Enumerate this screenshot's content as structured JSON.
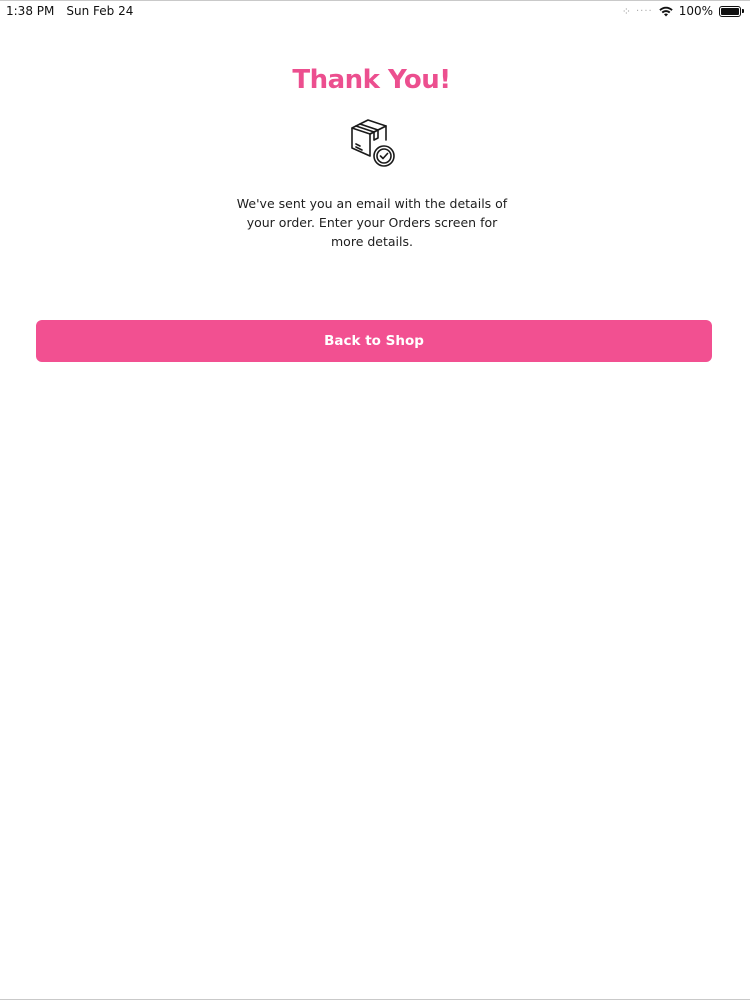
{
  "status_bar": {
    "time": "1:38 PM",
    "date": "Sun Feb 24",
    "battery": "100%",
    "battery_level": 1.0
  },
  "content": {
    "title": "Thank You!",
    "icon": "package-check-icon",
    "message": "We've sent you an email with the details of your order. Enter your Orders screen for more details."
  },
  "actions": {
    "back_label": "Back to Shop"
  },
  "colors": {
    "accent": "#ec4f8f",
    "button": "#f25091",
    "button_text": "#ffffff"
  }
}
